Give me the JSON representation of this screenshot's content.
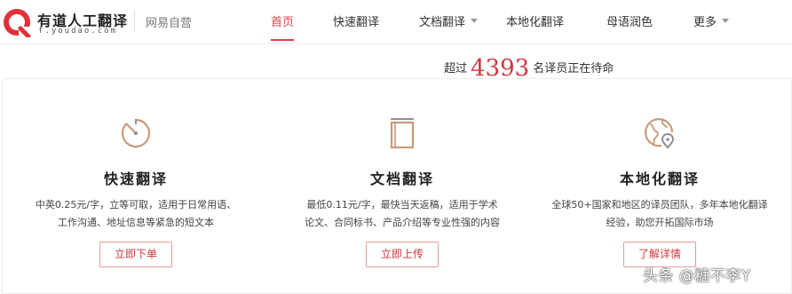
{
  "header": {
    "logo_title": "有道人工翻译",
    "logo_url": "f.youdao.com",
    "sub_brand": "网易自营",
    "nav": [
      {
        "label": "首页",
        "active": true,
        "has_dropdown": false
      },
      {
        "label": "快速翻译",
        "active": false,
        "has_dropdown": false
      },
      {
        "label": "文档翻译",
        "active": false,
        "has_dropdown": true
      },
      {
        "label": "本地化翻译",
        "active": false,
        "has_dropdown": false
      },
      {
        "label": "母语润色",
        "active": false,
        "has_dropdown": false
      },
      {
        "label": "更多",
        "active": false,
        "has_dropdown": true
      }
    ]
  },
  "waiting": {
    "prefix": "超过",
    "count": "4393",
    "suffix": "名译员正在待命"
  },
  "cards": [
    {
      "icon": "stopwatch-icon",
      "title": "快速翻译",
      "desc_line1": "中英0.25元/字，立等可取，适用于日常用语、",
      "desc_line2": "工作沟通、地址信息等紧急的短文本",
      "button": "立即下单"
    },
    {
      "icon": "document-icon",
      "title": "文档翻译",
      "desc_line1": "最低0.11元/字，最快当天返稿，适用于学术",
      "desc_line2": "论文、合同标书、产品介绍等专业性强的内容",
      "button": "立即上传"
    },
    {
      "icon": "globe-location-icon",
      "title": "本地化翻译",
      "desc_line1": "全球50+国家和地区的译员团队，多年本地化翻译",
      "desc_line2": "经验，助您开拓国际市场",
      "button": "了解详情"
    }
  ],
  "watermark": "头条 @糖不李Y",
  "colors": {
    "accent": "#d0383f",
    "active_nav": "#e0404a",
    "icon_tan": "#c89a7a",
    "icon_gray": "#8a8f96"
  }
}
